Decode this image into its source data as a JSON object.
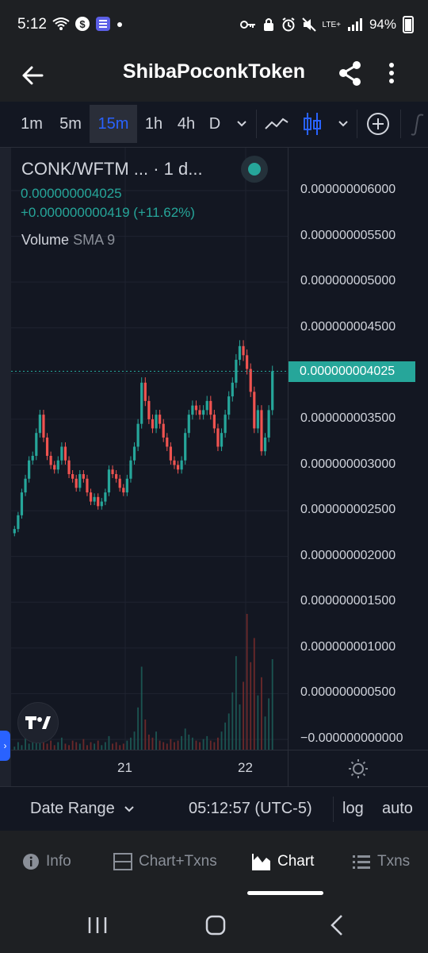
{
  "status_bar": {
    "time": "5:12",
    "battery_text": "94%",
    "lte_label": "LTE+",
    "icons": [
      "wifi-icon",
      "dollar-app-icon",
      "list-app-icon",
      "dot-icon",
      "key-icon",
      "lock-icon",
      "alarm-icon",
      "mute-icon",
      "signal-icon",
      "battery-icon"
    ]
  },
  "app_bar": {
    "title": "ShibaPoconkToken",
    "back_icon": "arrow-left-icon",
    "share_icon": "share-icon",
    "more_icon": "more-vertical-icon"
  },
  "toolbar": {
    "timeframes": [
      "1m",
      "5m",
      "15m",
      "1h",
      "4h",
      "D"
    ],
    "active_timeframe": "15m",
    "icons": [
      "chevron-down-icon",
      "line-chart-icon",
      "candles-icon",
      "chevron-down-icon",
      "add-indicator-icon",
      "fx-icon"
    ]
  },
  "legend": {
    "symbol": "CONK/WFTM ... · 1 d...",
    "price": "0.000000004025",
    "change": "+0.000000000419 (+11.62%)",
    "volume_label": "Volume",
    "sma_label": "SMA 9"
  },
  "price_axis": {
    "ticks": [
      "0.000000006000",
      "0.000000005500",
      "0.000000005000",
      "0.000000004500",
      "0.000000003500",
      "0.000000003000",
      "0.000000002500",
      "0.000000002000",
      "0.000000001500",
      "0.000000001000",
      "0.000000000500",
      "−0.000000000000"
    ],
    "last_price": "0.000000004025"
  },
  "time_axis": {
    "ticks": [
      "21",
      "22"
    ]
  },
  "bottom_controls": {
    "date_range": "Date Range",
    "clock": "05:12:57 (UTC-5)",
    "log": "log",
    "auto": "auto"
  },
  "bottom_nav": {
    "items": [
      {
        "label": "Info",
        "icon": "info-icon"
      },
      {
        "label": "Chart+Txns",
        "icon": "split-view-icon"
      },
      {
        "label": "Chart",
        "icon": "chart-area-icon"
      },
      {
        "label": "Txns",
        "icon": "list-icon"
      }
    ],
    "active": "Chart"
  },
  "colors": {
    "up": "#26a69a",
    "down": "#ef5350",
    "accent": "#2962ff",
    "background": "#131722"
  },
  "chart_data": {
    "type": "candlestick",
    "symbol": "CONK/WFTM",
    "interval": "15m",
    "x_ticks": [
      "21",
      "22"
    ],
    "ylim": [
      0,
      6.2e-09
    ],
    "last_price": 4.025e-09,
    "close_series": [
      2.3e-09,
      2.45e-09,
      2.7e-09,
      2.85e-09,
      3.05e-09,
      3.1e-09,
      3.35e-09,
      3.55e-09,
      3.3e-09,
      3.1e-09,
      3e-09,
      2.95e-09,
      3.05e-09,
      3.2e-09,
      3.05e-09,
      2.9e-09,
      2.85e-09,
      2.75e-09,
      2.9e-09,
      2.85e-09,
      2.7e-09,
      2.6e-09,
      2.65e-09,
      2.55e-09,
      2.6e-09,
      2.7e-09,
      2.95e-09,
      2.9e-09,
      2.85e-09,
      2.75e-09,
      2.7e-09,
      2.85e-09,
      3.05e-09,
      3.2e-09,
      3.45e-09,
      3.9e-09,
      3.7e-09,
      3.5e-09,
      3.4e-09,
      3.55e-09,
      3.45e-09,
      3.3e-09,
      3.2e-09,
      3.05e-09,
      3e-09,
      2.95e-09,
      3.05e-09,
      3.35e-09,
      3.55e-09,
      3.65e-09,
      3.6e-09,
      3.55e-09,
      3.6e-09,
      3.7e-09,
      3.55e-09,
      3.4e-09,
      3.2e-09,
      3.35e-09,
      3.55e-09,
      3.75e-09,
      3.9e-09,
      4.15e-09,
      4.3e-09,
      4.2e-09,
      4.05e-09,
      3.8e-09,
      3.4e-09,
      3.6e-09,
      3.15e-09,
      3.3e-09,
      3.6e-09,
      4.025e-09
    ],
    "volume_series": [
      0.02,
      0.05,
      0.03,
      0.08,
      0.04,
      0.06,
      0.1,
      0.05,
      0.12,
      0.04,
      0.06,
      0.03,
      0.05,
      0.08,
      0.04,
      0.03,
      0.06,
      0.05,
      0.04,
      0.07,
      0.03,
      0.05,
      0.04,
      0.06,
      0.03,
      0.05,
      0.09,
      0.04,
      0.05,
      0.03,
      0.04,
      0.06,
      0.08,
      0.12,
      0.28,
      0.55,
      0.2,
      0.1,
      0.08,
      0.12,
      0.06,
      0.05,
      0.04,
      0.07,
      0.05,
      0.06,
      0.09,
      0.14,
      0.1,
      0.08,
      0.06,
      0.05,
      0.07,
      0.09,
      0.06,
      0.05,
      0.08,
      0.12,
      0.18,
      0.24,
      0.38,
      0.62,
      0.3,
      0.45,
      0.9,
      0.58,
      0.74,
      0.36,
      0.48,
      0.22,
      0.34,
      0.6
    ]
  }
}
